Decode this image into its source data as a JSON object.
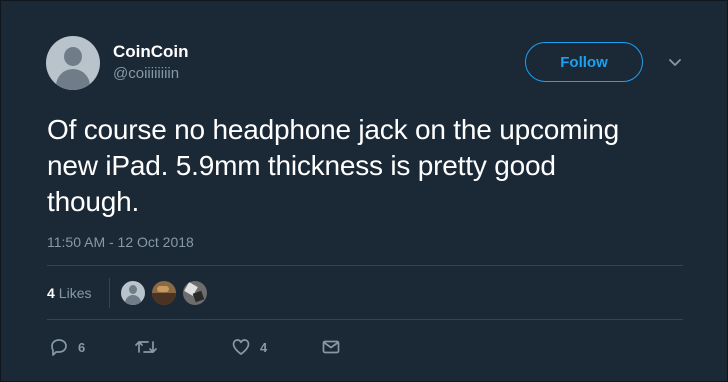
{
  "author": {
    "display_name": "CoinCoin",
    "handle": "@coiiiiiiiin",
    "avatar_icon": "default-profile-icon"
  },
  "follow_button": {
    "label": "Follow"
  },
  "menu": {
    "icon": "chevron-down-icon"
  },
  "tweet": {
    "text": "Of course no headphone jack on the upcoming new iPad. 5.9mm thickness is pretty good though.",
    "timestamp": "11:50 AM - 12 Oct 2018"
  },
  "stats": {
    "likes_count": "4",
    "likes_label": "Likes"
  },
  "actions": {
    "reply": {
      "icon": "reply-icon",
      "count": "6"
    },
    "retweet": {
      "icon": "retweet-icon",
      "count": ""
    },
    "like": {
      "icon": "heart-icon",
      "count": "4"
    },
    "dm": {
      "icon": "envelope-icon",
      "count": ""
    }
  },
  "colors": {
    "background": "#1b2836",
    "accent": "#1da1f2",
    "secondary_text": "#8899a6",
    "divider": "#38444d"
  }
}
